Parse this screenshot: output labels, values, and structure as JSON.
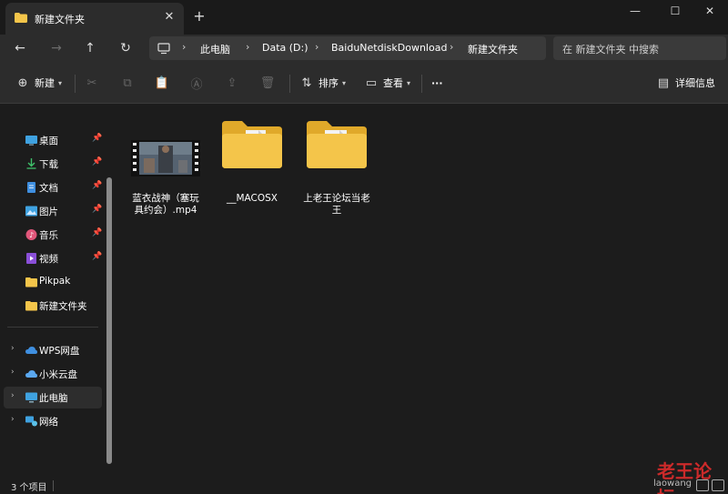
{
  "tab": {
    "title": "新建文件夹",
    "close_icon": "close-icon",
    "new_tab_icon": "plus-icon"
  },
  "window": {
    "minimize_icon": "minimize-icon",
    "maximize_icon": "maximize-icon",
    "close_icon": "close-icon"
  },
  "nav": {
    "back_icon": "arrow-left-icon",
    "forward_icon": "arrow-right-icon",
    "up_icon": "arrow-up-icon",
    "refresh_icon": "refresh-icon"
  },
  "breadcrumb": [
    "此电脑",
    "Data (D:)",
    "BaiduNetdiskDownload",
    "新建文件夹"
  ],
  "search": {
    "placeholder": "在 新建文件夹 中搜索"
  },
  "commands": {
    "new": "新建",
    "sort": "排序",
    "view": "查看",
    "more": "···",
    "details": "详细信息"
  },
  "sidebar": {
    "quick": [
      {
        "label": "桌面",
        "icon": "desktop-icon",
        "pinned": true
      },
      {
        "label": "下载",
        "icon": "download-icon",
        "pinned": true
      },
      {
        "label": "文档",
        "icon": "document-icon",
        "pinned": true
      },
      {
        "label": "图片",
        "icon": "picture-icon",
        "pinned": true
      },
      {
        "label": "音乐",
        "icon": "music-icon",
        "pinned": true
      },
      {
        "label": "视频",
        "icon": "video-icon",
        "pinned": true
      },
      {
        "label": "Pikpak",
        "icon": "folder-icon",
        "pinned": false
      },
      {
        "label": "新建文件夹",
        "icon": "folder-icon",
        "pinned": false
      }
    ],
    "roots": [
      {
        "label": "WPS网盘",
        "icon": "cloud-icon",
        "selected": false
      },
      {
        "label": "小米云盘",
        "icon": "cloud-icon",
        "selected": false
      },
      {
        "label": "此电脑",
        "icon": "computer-icon",
        "selected": true
      },
      {
        "label": "网络",
        "icon": "network-icon",
        "selected": false
      }
    ]
  },
  "files": [
    {
      "name_line1": "蓝衣战神（塞玩",
      "name_line2": "具约会）.mp4",
      "type": "video"
    },
    {
      "name_line1": "__MACOSX",
      "name_line2": "",
      "type": "folder"
    },
    {
      "name_line1": "上老王论坛当老",
      "name_line2": "王",
      "type": "folder"
    }
  ],
  "status": {
    "count": "3 个项目"
  },
  "watermark": {
    "text": "老王论坛",
    "sub": "laowang"
  },
  "colors": {
    "folder": "#f4c54a",
    "folder_dark": "#e0a92a",
    "accent": "#60cdff",
    "watermark": "#cc2a2a"
  }
}
